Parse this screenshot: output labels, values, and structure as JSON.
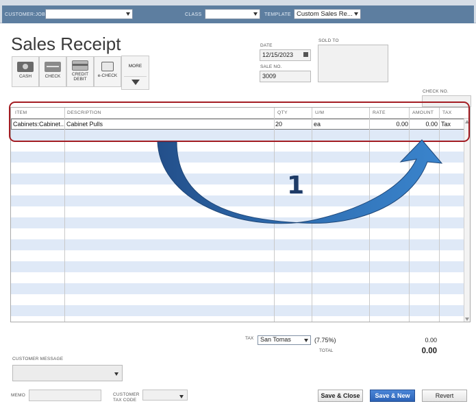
{
  "header": {
    "customer_job_label": "CUSTOMER:JOB",
    "customer_job_value": "",
    "class_label": "CLASS",
    "class_value": "",
    "template_label": "TEMPLATE",
    "template_value": "Custom Sales Re..."
  },
  "form": {
    "title": "Sales Receipt",
    "date_label": "DATE",
    "date_value": "12/15/2023",
    "sale_no_label": "SALE NO.",
    "sale_no_value": "3009",
    "sold_to_label": "SOLD TO",
    "check_no_label": "CHECK NO."
  },
  "payment_methods": [
    {
      "label": "CASH",
      "icon": "cash-icon"
    },
    {
      "label": "CHECK",
      "icon": "check-icon"
    },
    {
      "label": "CREDIT DEBIT",
      "icon": "credit-card-icon"
    },
    {
      "label": "e-CHECK",
      "icon": "echeck-icon"
    }
  ],
  "more_label": "MORE",
  "table": {
    "columns": [
      "ITEM",
      "DESCRIPTION",
      "QTY",
      "U/M",
      "RATE",
      "AMOUNT",
      "TAX"
    ],
    "rows": [
      {
        "item": "Cabinets:Cabinet...",
        "description": "Cabinet Pulls",
        "qty": "20",
        "um": "ea",
        "rate": "0.00",
        "amount": "0.00",
        "tax": "Tax"
      }
    ]
  },
  "annotation": {
    "step_number": "1",
    "highlight_color": "#a31c22",
    "arrow_color": "#2f6fb3"
  },
  "totals": {
    "tax_label": "TAX",
    "tax_value": "San Tomas",
    "tax_rate": "(7.75%)",
    "tax_amount": "0.00",
    "total_label": "TOTAL",
    "total_amount": "0.00"
  },
  "footer": {
    "customer_message_label": "CUSTOMER MESSAGE",
    "memo_label": "MEMO",
    "customer_tax_code_label_1": "CUSTOMER",
    "customer_tax_code_label_2": "TAX CODE",
    "save_close_label": "Save & Close",
    "save_new_label": "Save & New",
    "revert_label": "Revert"
  }
}
